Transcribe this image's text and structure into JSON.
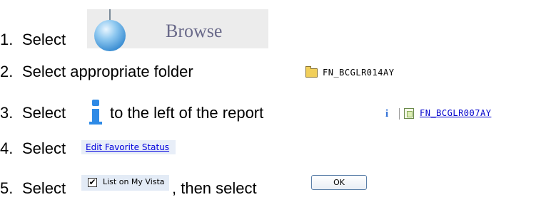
{
  "steps": [
    {
      "number": "1.",
      "text": "Select"
    },
    {
      "number": "2.",
      "text": "Select appropriate folder"
    },
    {
      "number": "3.",
      "text_before": "Select",
      "text_after": "to the left of the report"
    },
    {
      "number": "4.",
      "text": "Select"
    },
    {
      "number": "5.",
      "text_before": "Select",
      "text_after": ", then select"
    }
  ],
  "browse_button": {
    "label": "Browse",
    "icon": "globe-icon"
  },
  "folder": {
    "name": "FN_BCGLR014AY",
    "icon": "folder-icon"
  },
  "info_icon": {
    "glyph": "i",
    "icon": "info-icon",
    "color": "#2e8ae6"
  },
  "report": {
    "name": "FN_BCGLR007AY",
    "icon": "report-icon"
  },
  "edit_favorite": {
    "label": "Edit Favorite Status"
  },
  "list_on_vista": {
    "label": "List on My Vista",
    "checked": true
  },
  "ok_button": {
    "label": "OK"
  }
}
